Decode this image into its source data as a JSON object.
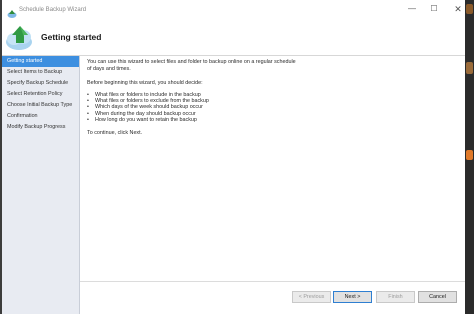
{
  "window": {
    "title": "Schedule Backup Wizard",
    "minimize_glyph": "—",
    "maximize_glyph": "☐",
    "close_glyph": "✕"
  },
  "header": {
    "title": "Getting started",
    "icon": "backup-cloud-icon"
  },
  "nav": {
    "items": [
      {
        "label": "Getting started",
        "active": true
      },
      {
        "label": "Select Items to Backup",
        "active": false
      },
      {
        "label": "Specify Backup Schedule",
        "active": false
      },
      {
        "label": "Select Retention Policy",
        "active": false
      },
      {
        "label": "Choose Initial Backup Type",
        "active": false
      },
      {
        "label": "Confirmation",
        "active": false
      },
      {
        "label": "Modify Backup Progress",
        "active": false
      }
    ]
  },
  "content": {
    "intro_line1": "You can use this wizard to select files and folder to backup online on a regular schedule",
    "intro_line2": "of days and times.",
    "decide": "Before beginning this wizard, you should decide:",
    "bullets": [
      "What files or folders to include in the backup",
      "What files or folders to exclude from the backup",
      "Which days of the week should backup occur",
      "When during the day should backup occur",
      "How long do you want to retain the backup"
    ],
    "bullet_glyph": "•",
    "continue": "To continue, click Next."
  },
  "footer": {
    "previous_label": "< Previous",
    "next_label": "Next >",
    "finish_label": "Finish",
    "cancel_label": "Cancel"
  },
  "colors": {
    "nav_active": "#3d8fe0",
    "nav_bg": "#e8ebf2",
    "primary_border": "#2f7fd1"
  }
}
